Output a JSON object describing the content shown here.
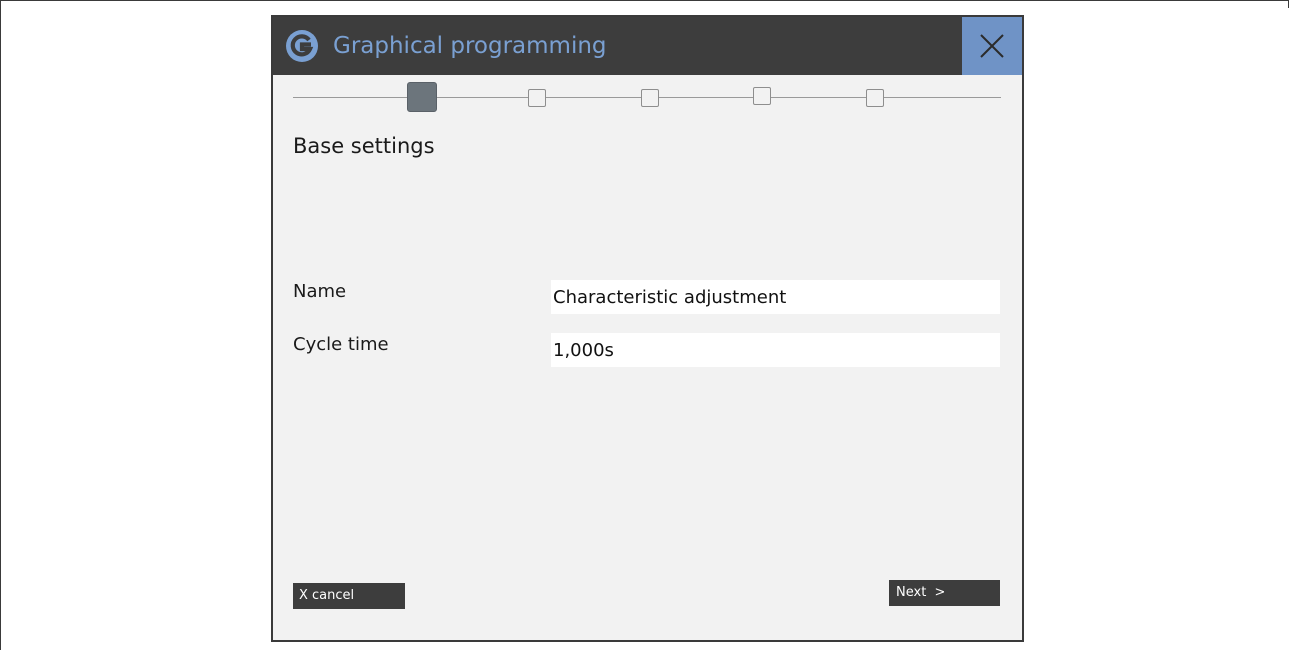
{
  "dialog": {
    "title": "Graphical programming",
    "close_icon": "close-icon",
    "title_icon": "logo-icon"
  },
  "wizard": {
    "total_steps": 5,
    "current_step": 1
  },
  "section": {
    "title": "Base settings"
  },
  "form": {
    "name_label": "Name",
    "name_value": "Characteristic adjustment",
    "cycle_label": "Cycle time",
    "cycle_value": "1,000s"
  },
  "footer": {
    "cancel_label": "X cancel",
    "next_label": "Next  >"
  },
  "colors": {
    "titlebar_bg": "#3d3d3d",
    "title_text": "#7aa0d2",
    "close_bg": "#6f93c6",
    "dialog_bg": "#f2f2f2",
    "active_step": "#6c757c"
  }
}
